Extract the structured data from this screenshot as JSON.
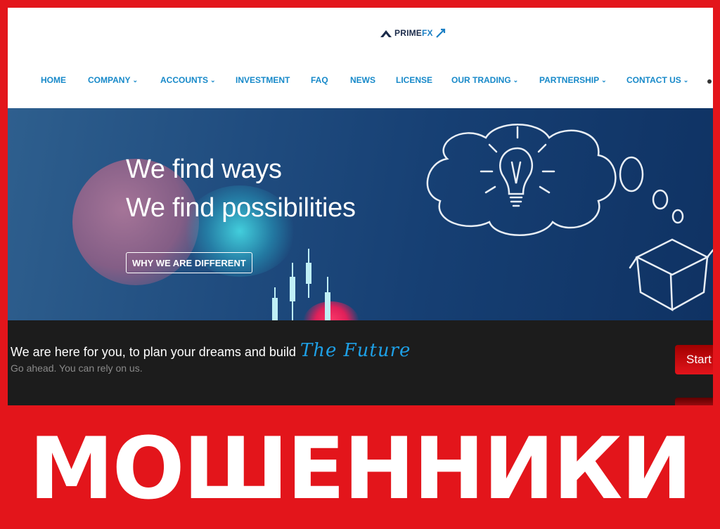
{
  "header": {
    "logo": {
      "prime": "PRIME",
      "fx": "FX"
    },
    "nav": [
      {
        "label": "HOME",
        "dropdown": false
      },
      {
        "label": "COMPANY",
        "dropdown": true
      },
      {
        "label": "ACCOUNTS",
        "dropdown": true
      },
      {
        "label": "INVESTMENT",
        "dropdown": false
      },
      {
        "label": "FAQ",
        "dropdown": false
      },
      {
        "label": "NEWS",
        "dropdown": false
      },
      {
        "label": "LICENSE",
        "dropdown": false
      },
      {
        "label": "OUR TRADING",
        "dropdown": true
      },
      {
        "label": "PARTNERSHIP",
        "dropdown": true
      },
      {
        "label": "CONTACT US",
        "dropdown": true
      }
    ],
    "chevron": "⌄"
  },
  "hero": {
    "line1": "We find ways",
    "line2": "We find possibilities",
    "button": "WHY WE ARE DIFFERENT"
  },
  "strip": {
    "main": "We are here for you, to plan your dreams and build",
    "highlight": "The Future",
    "sub": "Go ahead. You can rely on us.",
    "cta": "Start"
  },
  "stamp": {
    "text": "МОШЕННИКИ"
  },
  "colors": {
    "frame": "#e3151b",
    "nav_text": "#1789c9",
    "hero_bg": "#163f73",
    "strip_bg": "#1c1c1c",
    "future_text": "#1ea0e6"
  }
}
